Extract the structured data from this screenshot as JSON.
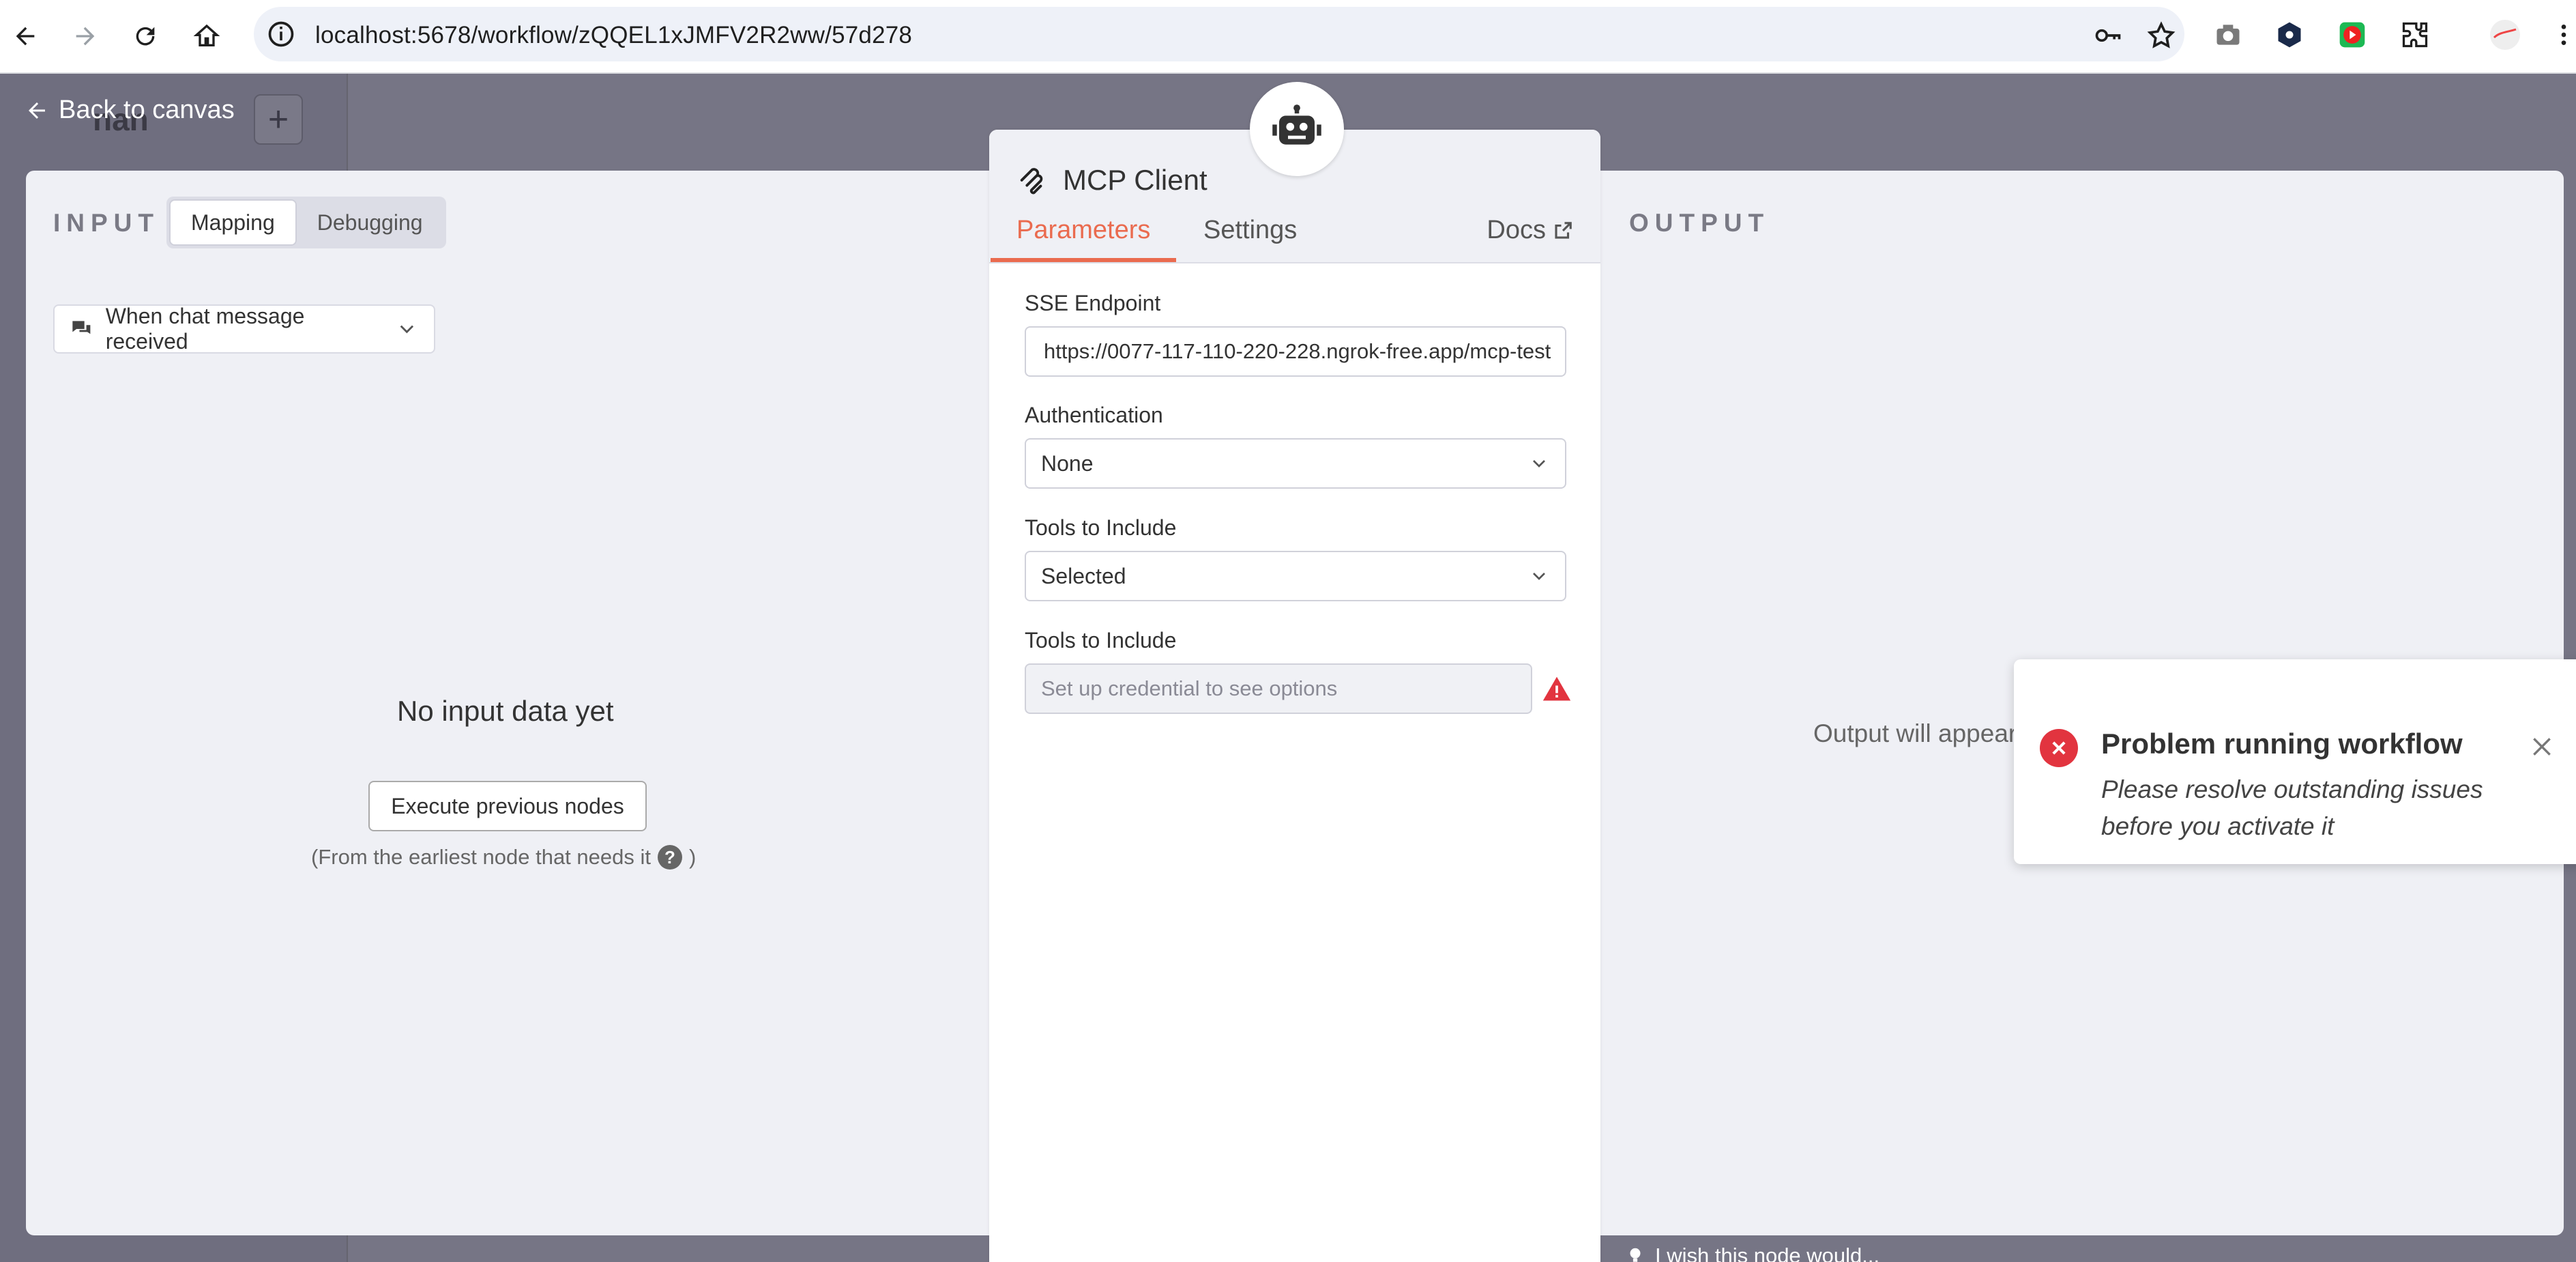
{
  "browser": {
    "url": "localhost:5678/workflow/zQQEL1xJMFV2R2ww/57d278"
  },
  "canvas": {
    "title": "nan",
    "back_label": "Back to canvas"
  },
  "input_panel": {
    "label": "INPUT",
    "tabs": [
      "Mapping",
      "Debugging"
    ],
    "active_tab": "Mapping",
    "trigger_select": "When chat message received",
    "empty_title": "No input data yet",
    "execute_button": "Execute previous nodes",
    "hint_prefix": "(From the earliest node that needs it",
    "hint_suffix": ")"
  },
  "node": {
    "title": "MCP Client",
    "tabs": [
      "Parameters",
      "Settings"
    ],
    "active_tab": "Parameters",
    "docs_label": "Docs",
    "fields": {
      "sse_label": "SSE Endpoint",
      "sse_value": "https://0077-117-110-220-228.ngrok-free.app/mcp-test",
      "auth_label": "Authentication",
      "auth_value": "None",
      "tools_label_1": "Tools to Include",
      "tools_value_1": "Selected",
      "tools_label_2": "Tools to Include",
      "tools_placeholder_2": "Set up credential to see options"
    }
  },
  "output_panel": {
    "label": "OUTPUT",
    "message": "Output will appear"
  },
  "toast": {
    "title": "Problem running workflow",
    "body": "Please resolve outstanding issues before you activate it"
  },
  "footer": {
    "feedback_hint": "I wish this node would..."
  },
  "colors": {
    "accent": "#ea6b4f",
    "error": "#e2343f",
    "overlay": "#767585"
  }
}
